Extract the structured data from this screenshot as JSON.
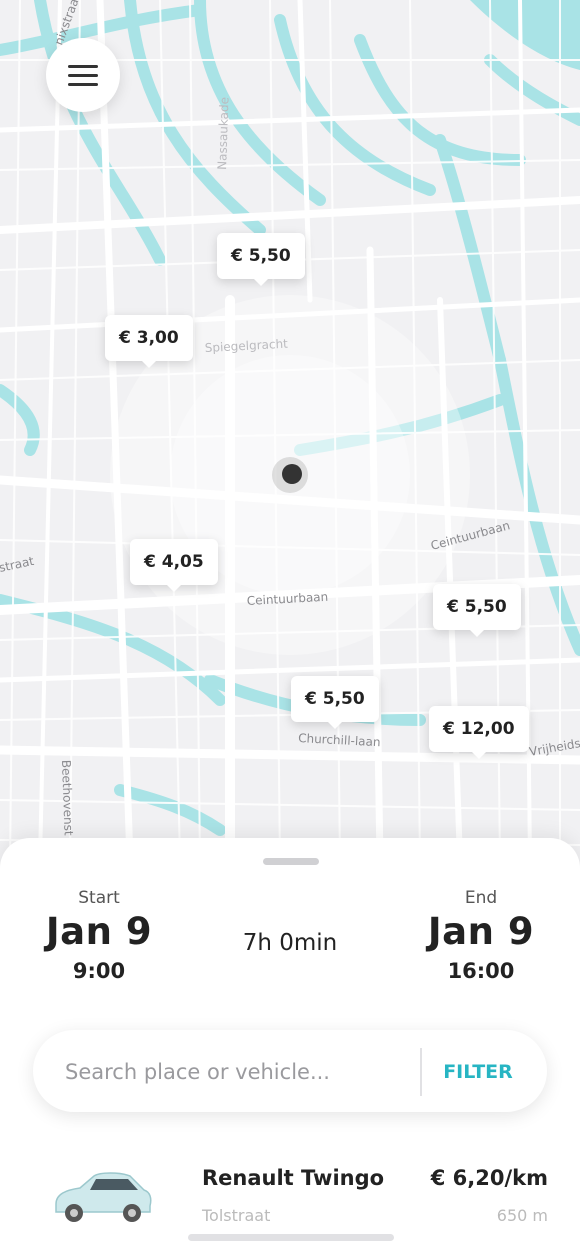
{
  "map": {
    "street_labels": [
      "Spiegelgracht",
      "Ceintuurbaan",
      "Ceintuurbaan",
      "Churchill-laan",
      "Vrijheids",
      "Beethovenst",
      "straat",
      "Nassaukade",
      "nixstraat"
    ],
    "price_markers": [
      "€ 5,50",
      "€ 3,00",
      "€ 4,05",
      "€ 5,50",
      "€ 5,50",
      "€ 12,00"
    ],
    "colors": {
      "background": "#f1f1f3",
      "water": "#a9e3e6",
      "roads": "#ffffff",
      "location_dot": "#333333"
    }
  },
  "menu": {
    "icon": "hamburger-icon"
  },
  "booking": {
    "start_label": "Start",
    "start_date": "Jan 9",
    "start_time": "9:00",
    "duration": "7h 0min",
    "end_label": "End",
    "end_date": "Jan 9",
    "end_time": "16:00"
  },
  "search": {
    "placeholder": "Search place or vehicle...",
    "value": "",
    "filter_label": "FILTER",
    "accent": "#27b5c3"
  },
  "vehicles": [
    {
      "name": "Renault Twingo",
      "rate": "€ 6,20/km",
      "sub": "Tolstraat",
      "sub_right": "650 m"
    }
  ]
}
